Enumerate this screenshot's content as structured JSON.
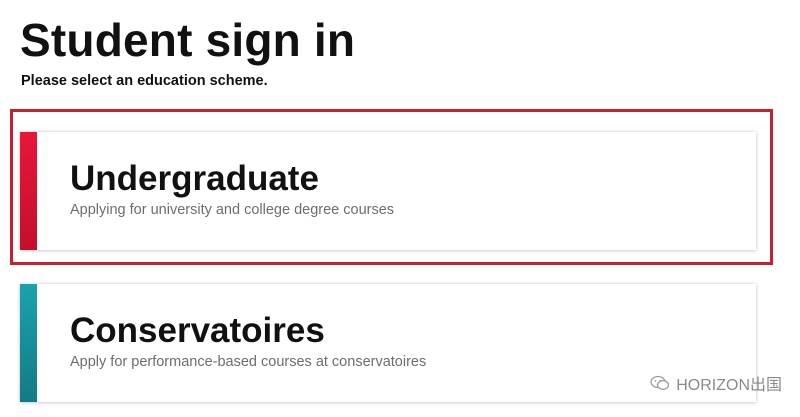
{
  "header": {
    "title": "Student sign in",
    "subtitle": "Please select an education scheme."
  },
  "schemes": [
    {
      "title": "Undergraduate",
      "description": "Applying for university and college degree courses",
      "accent_color": "#d4142e"
    },
    {
      "title": "Conservatoires",
      "description": "Apply for performance-based courses at conservatoires",
      "accent_color": "#1a8a94"
    }
  ],
  "highlight_color": "#c8202c",
  "watermark": {
    "text": "HORIZON出国",
    "icon": "wechat-icon"
  }
}
